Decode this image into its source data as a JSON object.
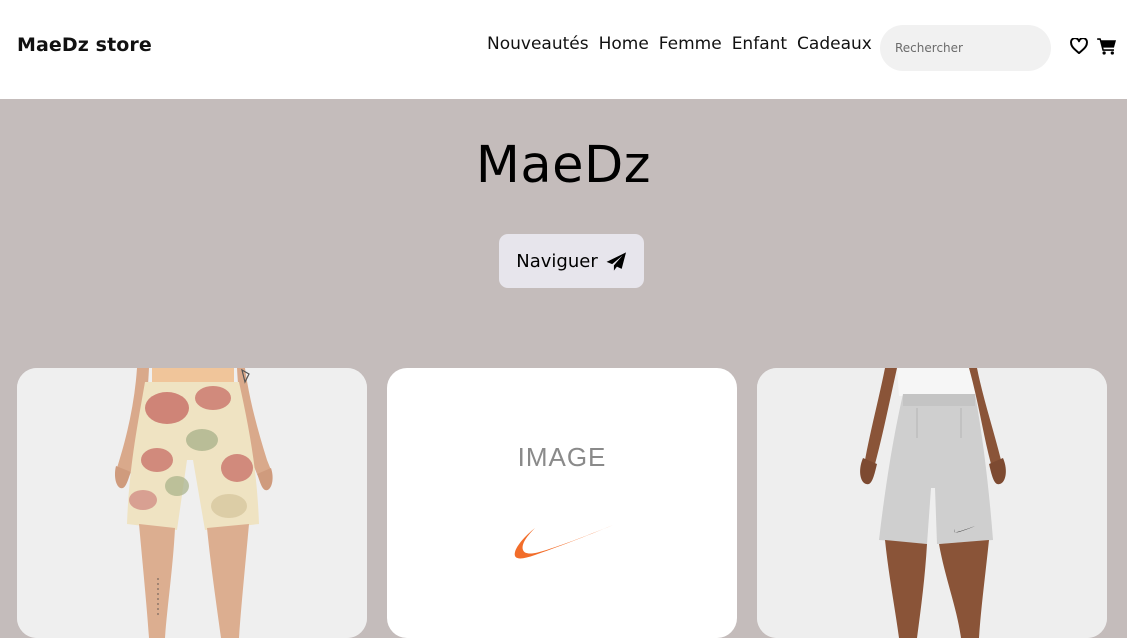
{
  "header": {
    "brand": "MaeDz store",
    "nav": [
      "Nouveautés",
      "Home",
      "Femme",
      "Enfant",
      "Cadeaux"
    ],
    "search_placeholder": "Rechercher",
    "icons": [
      "heart-icon",
      "cart-icon"
    ]
  },
  "hero": {
    "title": "MaeDz",
    "cta_label": "Naviguer",
    "cta_icon": "paper-plane-icon"
  },
  "products": [
    {
      "image": "tie-dye shorts photo"
    },
    {
      "image_text": "IMAGE",
      "logo": "swoosh"
    },
    {
      "image": "grey shorts photo"
    }
  ],
  "colors": {
    "header_bg": "#ffffff",
    "page_bg": "#c4bcbb",
    "search_bg": "#f1f1f1",
    "cta_bg": "#e7e5ec",
    "swoosh": "#f26d2a"
  }
}
